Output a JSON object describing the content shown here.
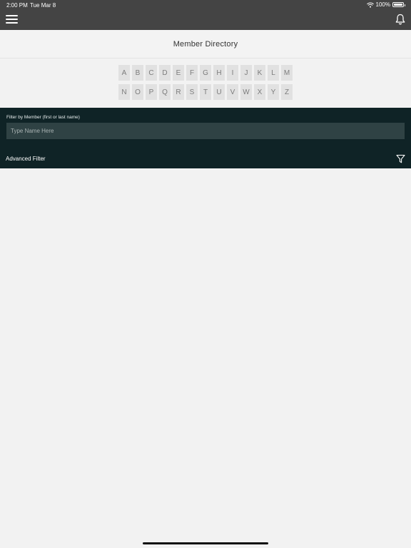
{
  "status_bar": {
    "time": "2:00 PM",
    "date": "Tue Mar 8",
    "battery": "100%",
    "wifi_icon": "wifi-icon",
    "battery_icon": "battery-icon"
  },
  "nav": {
    "menu_icon": "hamburger-menu-icon",
    "bell_icon": "bell-icon"
  },
  "page": {
    "title": "Member Directory"
  },
  "alphabet": {
    "row1": [
      "A",
      "B",
      "C",
      "D",
      "E",
      "F",
      "G",
      "H",
      "I",
      "J",
      "K",
      "L",
      "M"
    ],
    "row2": [
      "N",
      "O",
      "P",
      "Q",
      "R",
      "S",
      "T",
      "U",
      "V",
      "W",
      "X",
      "Y",
      "Z"
    ]
  },
  "filter": {
    "label": "Filter by Member (first or last name)",
    "placeholder": "Type Name Here",
    "value": "",
    "advanced_label": "Advanced Filter",
    "advanced_icon": "funnel-icon"
  },
  "colors": {
    "nav_bg": "#444444",
    "filter_bg": "#0f2326",
    "input_bg": "#2f4244",
    "page_bg": "#f2f2f2",
    "key_bg": "#e1e1e1"
  }
}
